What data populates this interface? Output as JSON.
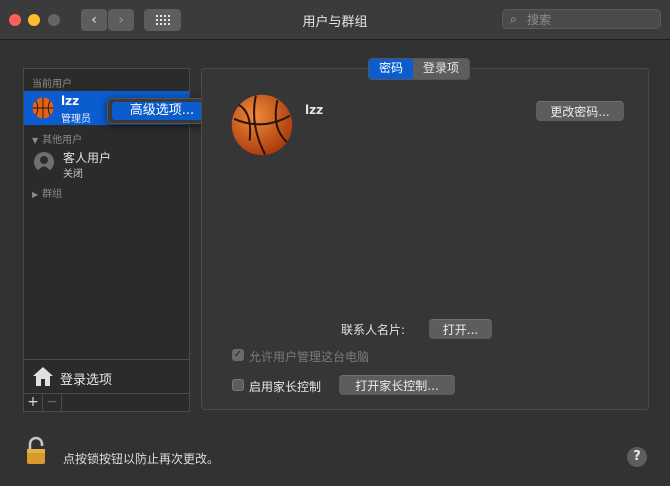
{
  "window": {
    "title": "用户与群组"
  },
  "search": {
    "placeholder": "搜索"
  },
  "sidebar": {
    "current_users_header": "当前用户",
    "current_user": {
      "name": "lzz",
      "role": "管理员"
    },
    "other_users_header": "其他用户",
    "guest": {
      "name": "客人用户",
      "status": "关闭"
    },
    "groups_header": "群组",
    "login_options_label": "登录选项",
    "add_label": "+",
    "remove_label": "−"
  },
  "context_menu": {
    "advanced_options": "高级选项..."
  },
  "tabs": {
    "password": "密码",
    "login_items": "登录项"
  },
  "user_detail": {
    "name": "lzz",
    "change_password_button": "更改密码...",
    "contact_card_label": "联系人名片:",
    "open_button": "打开...",
    "allow_admin_label": "允许用户管理这台电脑",
    "allow_admin_checked": true,
    "parental_controls_label": "启用家长控制",
    "parental_controls_checked": false,
    "open_parental_controls_button": "打开家长控制..."
  },
  "footer": {
    "lock_text": "点按锁按钮以防止再次更改。",
    "help_label": "?"
  },
  "colors": {
    "accent": "#0b5ccf",
    "background": "#323232"
  },
  "icons": [
    "back-icon",
    "forward-icon",
    "grid-icon",
    "search-icon",
    "basketball-avatar-icon",
    "guest-avatar-icon",
    "house-icon",
    "lock-icon",
    "help-icon"
  ]
}
